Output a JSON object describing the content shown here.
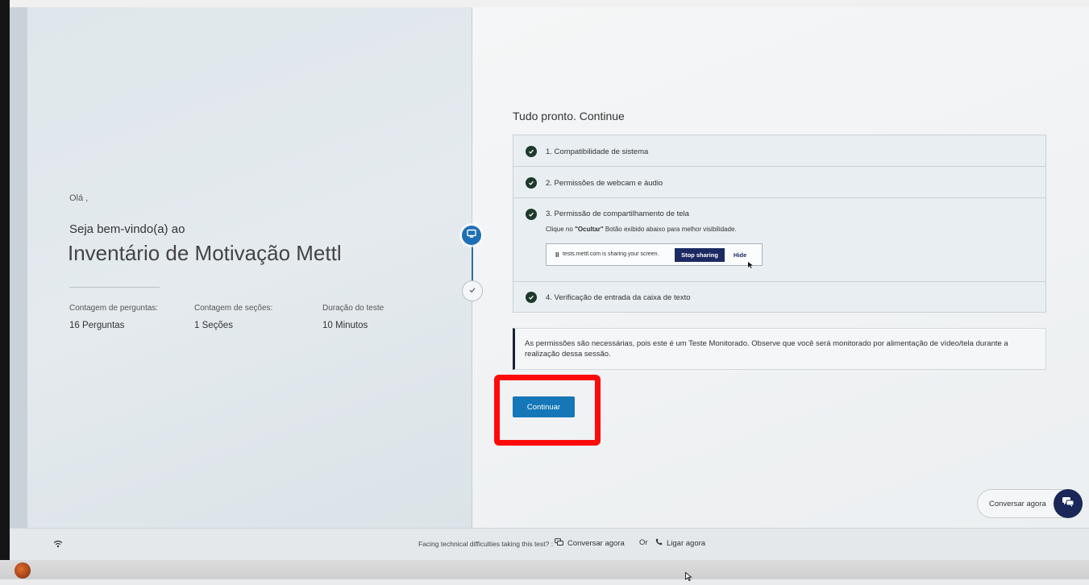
{
  "left": {
    "greeting": "Olá ,",
    "welcome": "Seja bem-vindo(a) ao",
    "test_title": "Inventário de Motivação Mettl",
    "stats": [
      {
        "label": "Contagem de perguntas:",
        "value": "16 Perguntas"
      },
      {
        "label": "Contagem de seções:",
        "value": "1 Seções"
      },
      {
        "label": "Duração do teste",
        "value": "10 Minutos"
      }
    ]
  },
  "right": {
    "title": "Tudo pronto. Continue",
    "checks": [
      {
        "label": "1. Compatibilidade de sistema"
      },
      {
        "label": "2. Permissões de webcam e áudio"
      },
      {
        "label": "3. Permissão de compartilhamento de tela"
      },
      {
        "label": "4. Verificação de entrada da caixa de texto"
      }
    ],
    "hint": {
      "prefix": "Clique no ",
      "bold": "\"Ocultar\"",
      "suffix": " Botão exibido abaixo para melhor visibilidade."
    },
    "share_bar": {
      "pause": "II",
      "text": "tests.mettl.com is sharing your screen.",
      "stop_label": "Stop sharing",
      "hide_label": "Hide"
    },
    "notice": "As permissões são necessárias, pois este é um Teste Monitorado. Observe que você será monitorado por alimentação de vídeo/tela durante a realização dessa sessão.",
    "continue_label": "Continuar"
  },
  "chat": {
    "label": "Conversar agora"
  },
  "footer": {
    "help_text": "Facing technical difficulties taking this test? :",
    "chat_label": "Conversar agora",
    "or_text": "Or",
    "call_label": "Ligar agora"
  },
  "colors": {
    "primary": "#1577b8",
    "highlight": "#ff0a0a",
    "stop_button": "#1c2a63",
    "check": "#1e3a2a"
  },
  "icons": [
    "monitor-icon",
    "check-icon",
    "checkmark-circle-icon",
    "chat-icon",
    "wifi-icon",
    "phone-icon",
    "cursor-icon"
  ]
}
